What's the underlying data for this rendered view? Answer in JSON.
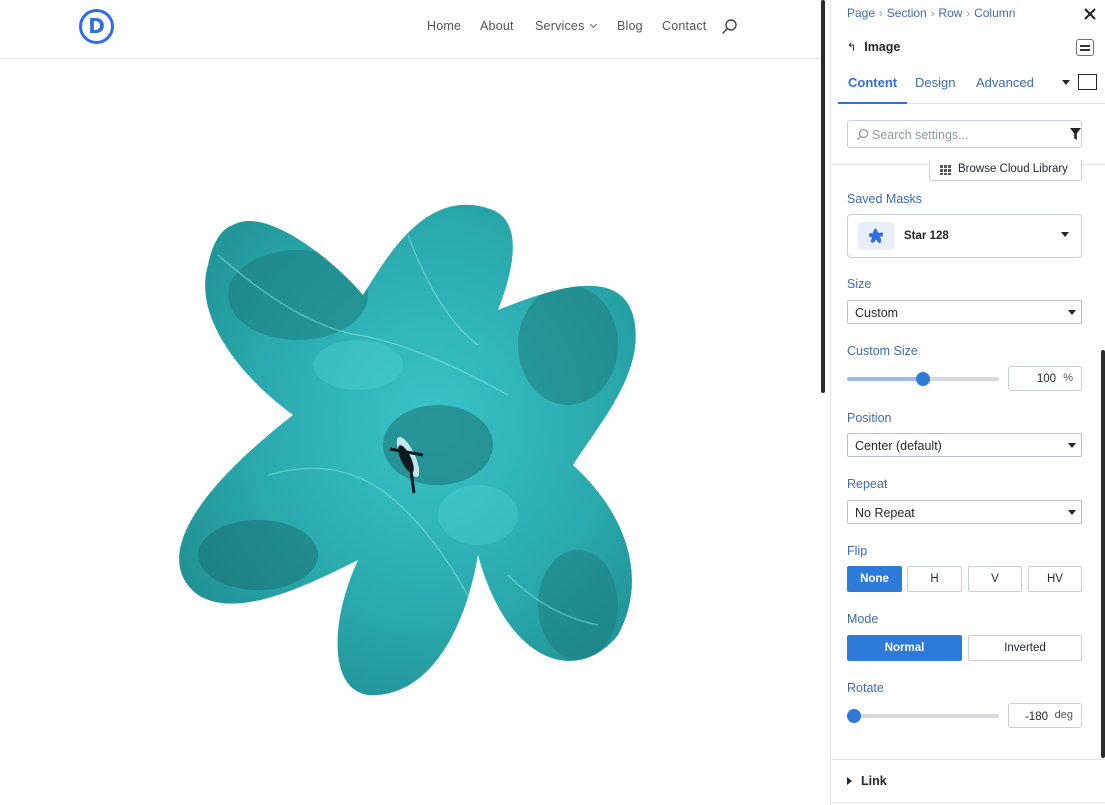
{
  "site": {
    "logo_letter": "D",
    "nav": [
      {
        "label": "Home"
      },
      {
        "label": "About"
      },
      {
        "label": "Services",
        "has_dropdown": true
      },
      {
        "label": "Blog"
      },
      {
        "label": "Contact"
      }
    ],
    "accent_color": "#2e6de6",
    "image": {
      "icon": "star-mask-ocean-photo",
      "colors": [
        "#2aa9ad",
        "#38c3c6",
        "#156a6c"
      ]
    }
  },
  "panel": {
    "breadcrumb": [
      "Page",
      "Section",
      "Row",
      "Column"
    ],
    "module_title": "Image",
    "tabs": [
      {
        "label": "Content",
        "active": true
      },
      {
        "label": "Design",
        "active": false
      },
      {
        "label": "Advanced",
        "active": false
      }
    ],
    "search": {
      "placeholder": "Search settings..."
    },
    "cloud_button": "Browse Cloud Library",
    "saved_masks": {
      "label": "Saved Masks",
      "value": "Star 128"
    },
    "size": {
      "label": "Size",
      "value": "Custom"
    },
    "custom_size": {
      "label": "Custom Size",
      "value": "100",
      "unit": "%",
      "slider_fraction": 0.5
    },
    "position": {
      "label": "Position",
      "value": "Center (default)"
    },
    "repeat": {
      "label": "Repeat",
      "value": "No Repeat"
    },
    "flip": {
      "label": "Flip",
      "options": [
        "None",
        "H",
        "V",
        "HV"
      ],
      "selected": "None"
    },
    "mode": {
      "label": "Mode",
      "options": [
        "Normal",
        "Inverted"
      ],
      "selected": "Normal"
    },
    "rotate": {
      "label": "Rotate",
      "value": "-180",
      "unit": "deg",
      "slider_fraction": 0.0
    },
    "link_section": "Link",
    "accent_color": "#2e7ad8"
  }
}
